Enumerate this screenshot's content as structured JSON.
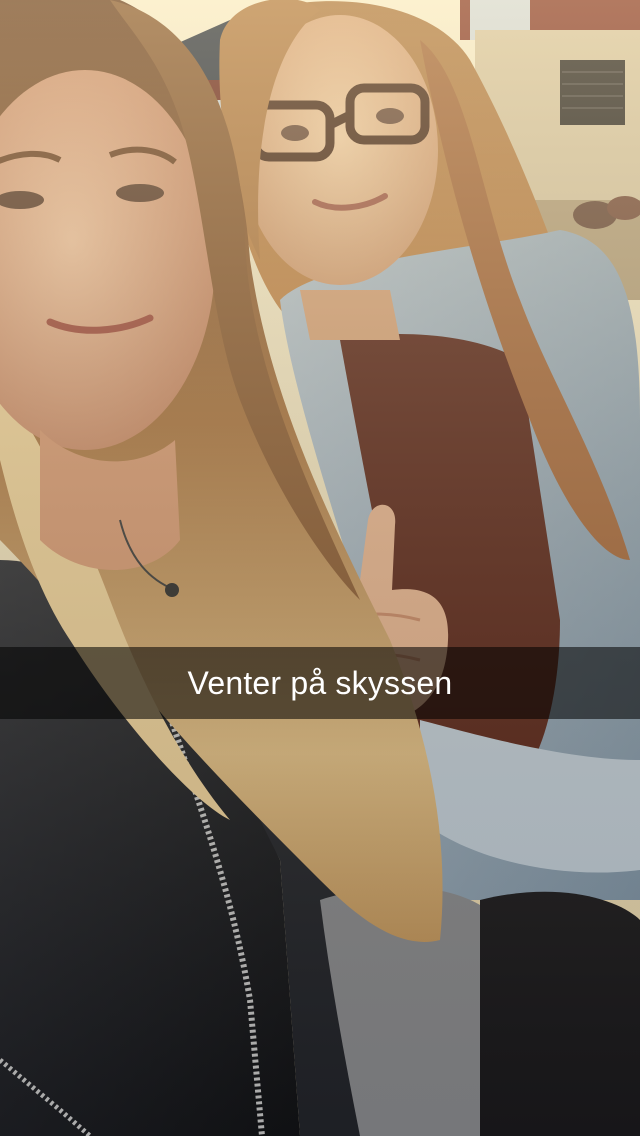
{
  "snap": {
    "caption": "Venter på skyssen"
  },
  "photo": {
    "subject": "selfie-two-women-outdoors",
    "colors": {
      "sky": "#f3e7c4",
      "brick": "#8a3a2a",
      "concrete": "#d9c9a8",
      "hair": "#c8965e",
      "skin": "#e0a985",
      "denim": "#9fb2c4",
      "leather": "#1c1d22",
      "sweater": "#7b7c7e",
      "shirt": "#5a2418"
    }
  }
}
